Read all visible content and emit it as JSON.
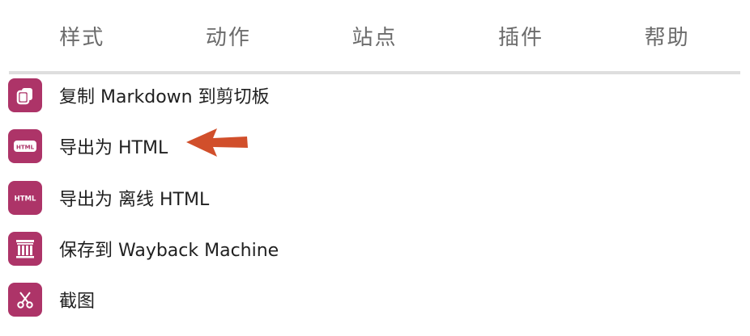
{
  "tabs": [
    {
      "label": "样式",
      "active": false
    },
    {
      "label": "动作",
      "active": true
    },
    {
      "label": "站点",
      "active": false
    },
    {
      "label": "插件",
      "active": false
    },
    {
      "label": "帮助",
      "active": false
    }
  ],
  "menu": {
    "items": [
      {
        "label": "复制 Markdown 到剪切板",
        "icon": "copy-icon"
      },
      {
        "label": "导出为 HTML",
        "icon": "html-icon",
        "icon_text": "HTML"
      },
      {
        "label": "导出为 离线 HTML",
        "icon": "offline-html-icon",
        "icon_text": "HTML"
      },
      {
        "label": "保存到 Wayback Machine",
        "icon": "archive-icon"
      },
      {
        "label": "截图",
        "icon": "scissors-icon"
      }
    ]
  },
  "colors": {
    "accent": "#6f9a8c",
    "icon_bg": "#ad3468",
    "arrow": "#d14f2b"
  }
}
